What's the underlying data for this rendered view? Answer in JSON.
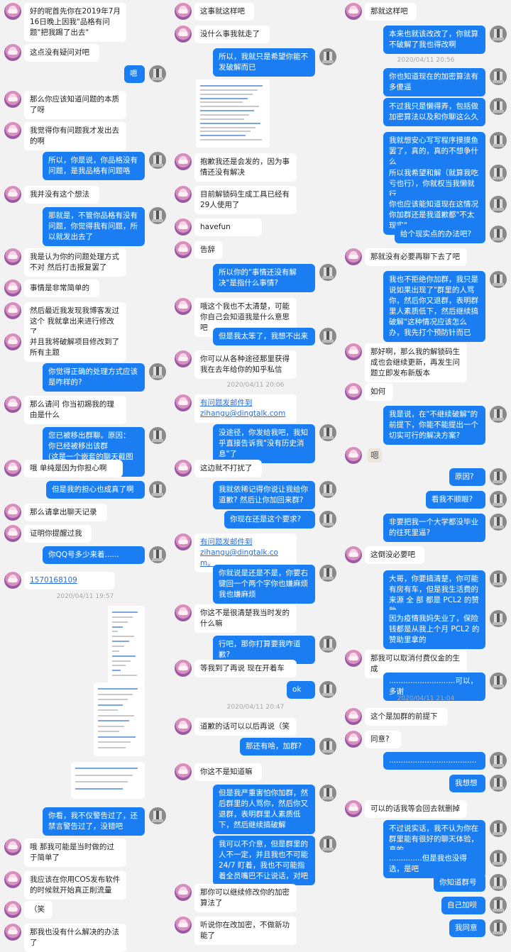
{
  "col1": [
    {
      "side": "l",
      "text": "好的呢首先你在2019年7月16日晚上因我\"品格有问题\"把我踢了出去\""
    },
    {
      "side": "l",
      "text": "这点没有疑问对吧"
    },
    {
      "side": "r",
      "text": "嗯"
    },
    {
      "side": "l",
      "text": "那么你应该知道问题的本质了呀"
    },
    {
      "side": "l",
      "text": "我觉得你有问题我才发出去的啊"
    },
    {
      "side": "r",
      "text": "所以，你是说，你品格没有问题，是我品格有问题咯"
    },
    {
      "side": "l",
      "text": "我并没有这个想法"
    },
    {
      "side": "r",
      "text": "那就是，不管你品格有没有问题，你觉得我有问题，所以就发出去了"
    },
    {
      "side": "l",
      "text": "我是认为你的问题处理方式不对 然后打击报复罢了"
    },
    {
      "side": "l",
      "text": "事情是非常简单的"
    },
    {
      "side": "l",
      "text": "然后最近我发现我博客发过这个 我就拿出来进行修改了"
    },
    {
      "side": "l",
      "text": "并且我将破解项目修改到了所有主题"
    },
    {
      "side": "r",
      "text": "你觉得正确的处理方式应该是咋样的?"
    },
    {
      "side": "l",
      "text": "那么请问 你当初踢我的理由是什么"
    },
    {
      "side": "r",
      "text": "您已被移出群聊。原因：\n你已经被移出该群\n(这是一个嵌套的聊天截图内容)"
    },
    {
      "side": "l",
      "text": "哦 单纯是因为你担心啊"
    },
    {
      "side": "r",
      "text": "但是我的担心也成真了啊"
    },
    {
      "side": "l",
      "text": "那么请拿出聊天记录"
    },
    {
      "side": "l",
      "text": "证明你提醒过我"
    },
    {
      "side": "r",
      "text": "你QQ号多少来着......"
    },
    {
      "side": "l",
      "text": "1570168109"
    },
    {
      "time": "2020/04/11 19:57"
    },
    {
      "side": "r",
      "text": "你看，我不仅警告过了，还禁言警告过了，没错吧"
    },
    {
      "side": "l",
      "text": "哦 那我可能是当时做的过于简单了"
    },
    {
      "side": "l",
      "text": "我应该在你用COS发布软件的时候就开始真正削流量"
    },
    {
      "side": "l",
      "text": "（笑"
    },
    {
      "side": "l",
      "text": "那我也没有什么解决的办法了"
    }
  ],
  "col2": [
    {
      "side": "l",
      "text": "这事就这样吧"
    },
    {
      "side": "l",
      "text": "没什么事我就走了"
    },
    {
      "side": "r",
      "text": "所以，我就只是希望你能不发破解而已"
    },
    {
      "side": "l",
      "text": "抱歉我还是会发的，因为事情还没有解决"
    },
    {
      "side": "l",
      "text": "目前解锁码生成工具已经有29人使用了"
    },
    {
      "side": "l",
      "text": "havefun"
    },
    {
      "side": "l",
      "text": "告辞"
    },
    {
      "side": "r",
      "text": "所以你的\"事情还没有解决\"是指什么事情?"
    },
    {
      "side": "l",
      "text": "哦这个我也不太清楚，可能你自己会知道我是什么意思吧"
    },
    {
      "side": "r",
      "text": "但是我太笨了，我想不出来"
    },
    {
      "side": "l",
      "text": "你可以从各种途径那里获得我在去年给你的知乎私信"
    },
    {
      "time": "2020/04/11 20:06"
    },
    {
      "side": "l",
      "text": "有问题发邮件到\nzihangu@dingtalk.com"
    },
    {
      "side": "r",
      "text": "没途径，你发给我吧，我知乎直接告诉我\"没有历史消息\"了"
    },
    {
      "side": "l",
      "text": "这边就不打扰了"
    },
    {
      "side": "r",
      "text": "我就依稀记得你说让我给你道歉? 然后让你加回来群?"
    },
    {
      "side": "r",
      "text": "你现在还是这个要求?"
    },
    {
      "side": "l",
      "text": "有问题发邮件到\nzihangu@dingtalk.com。"
    },
    {
      "side": "r",
      "text": "你就说是还是不是，你要右键回一个两个字你也嫌麻烦我也嫌麻烦"
    },
    {
      "side": "l",
      "text": "你这不是很清楚我当时发的什么嘛"
    },
    {
      "side": "r",
      "text": "行吧，那你打算要我咋道歉?"
    },
    {
      "side": "l",
      "text": "等我到了再说 现在开着车"
    },
    {
      "side": "r",
      "text": "ok"
    },
    {
      "time": "2020/04/11 20:47"
    },
    {
      "side": "l",
      "text": "道歉的话可以以后再说（笑"
    },
    {
      "side": "r",
      "text": "那还有啥，加群?"
    },
    {
      "side": "l",
      "text": "你这不是知道嘛"
    },
    {
      "side": "r",
      "text": "但是我严重害怕你加群，然后群里的人骂你，然后你又退群，表明群里人素质低下，然后继续搞破解"
    },
    {
      "side": "r",
      "text": "我可以不介意，但是群里的人不一定，并且我也不可能 24/7 盯着，我也不可能指着全员嘴巴不让说话，对吧"
    },
    {
      "side": "l",
      "text": "那你可以继续修改你的加密算法了"
    },
    {
      "side": "l",
      "text": "听说你在改加密，不做新功能了"
    }
  ],
  "col3": [
    {
      "side": "l",
      "text": "那就这样吧"
    },
    {
      "side": "r",
      "text": "本来也就该改改了，你就算不破解了我也得改啊"
    },
    {
      "time": "2020/04/11 20:56"
    },
    {
      "side": "r",
      "text": "你也知道现在的加密算法有多傻逼"
    },
    {
      "side": "r",
      "text": "不过我只是懒得弄，包括做加密算法以及和你聊这么久"
    },
    {
      "side": "r",
      "text": "我就想安心写写程序摸摸鱼罢了，真的，真的不想争什么"
    },
    {
      "side": "r",
      "text": "所以我希望和解（就算我吃亏也行），你就权当我懒就行"
    },
    {
      "side": "r",
      "text": "你也应该能知道现在这情况你加群还是我道歉都\"不太现实\""
    },
    {
      "side": "r",
      "text": "给个现实点的办法吧?"
    },
    {
      "side": "l",
      "text": "那就没有必要再聊下去了吧"
    },
    {
      "side": "r",
      "text": "我也不拒绝你加群，我只是说如果出现了\"群里的人骂你，然后你又退群，表明群里人素质低下，然后继续搞破解\"这种情况应该怎么办，我先打个预防针而已"
    },
    {
      "side": "l",
      "text": "那好啊，那么我的解锁码生成也会继续更新，再发生问题立即发布新版本"
    },
    {
      "side": "l",
      "text": "如何"
    },
    {
      "side": "r",
      "text": "我是说，在\"不继续破解\"的前提下，你能不能提出一个切实可行的解决方案?"
    },
    {
      "side": "l",
      "sticker": "嗯"
    },
    {
      "side": "r",
      "text": "原因?"
    },
    {
      "side": "r",
      "text": "看我不顺眼?"
    },
    {
      "side": "r",
      "text": "非要把我一个大学都没毕业的往死里逼?"
    },
    {
      "side": "l",
      "text": "这倒没必要吧"
    },
    {
      "side": "r",
      "text": "大哥，你要搞清楚，你可能有房有车，但是我生活费的来源 全 部 都是 PCL2 的赞助"
    },
    {
      "side": "r",
      "text": "因为疫情我妈失业了，保险钱都是从我上个月 PCL2 的赞助里拿的"
    },
    {
      "side": "l",
      "text": "那我可以取消付费仪金的生成"
    },
    {
      "side": "r",
      "text": "............................可以，多谢"
    },
    {
      "time": "2020/04/11 21:04"
    },
    {
      "side": "l",
      "text": "这个是加群的前提下"
    },
    {
      "side": "l",
      "text": "同意?"
    },
    {
      "side": "r",
      "text": "....................................."
    },
    {
      "side": "r",
      "text": "我想想"
    },
    {
      "side": "l",
      "text": "可以的话我等会回去就删掉"
    },
    {
      "side": "r",
      "text": "不过说实话，我不认为你在群里能有很好的聊天体验，真的......"
    },
    {
      "side": "r",
      "text": "..............但是我也没得选，是吧"
    },
    {
      "side": "r",
      "text": "你知道群号"
    },
    {
      "side": "r",
      "text": "自己加呗"
    },
    {
      "side": "r",
      "text": "我同意"
    }
  ]
}
